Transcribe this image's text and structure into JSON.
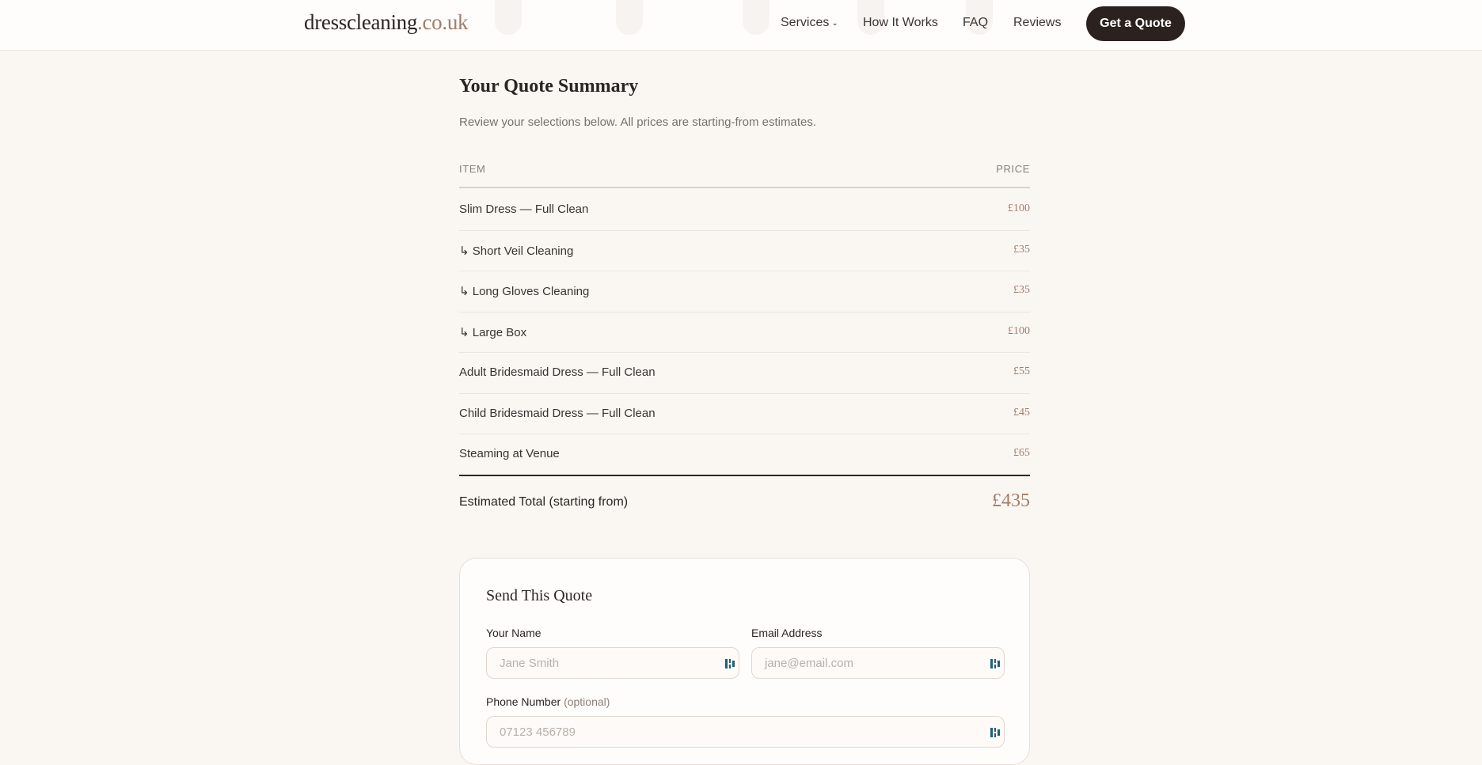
{
  "header": {
    "logo_main": "dresscleaning",
    "logo_tld": ".co.uk",
    "nav": {
      "services": "Services",
      "how_it_works": "How It Works",
      "faq": "FAQ",
      "reviews": "Reviews"
    },
    "cta_label": "Get a Quote"
  },
  "summary": {
    "title": "Your Quote Summary",
    "subtitle": "Review your selections below. All prices are starting-from estimates.",
    "columns": {
      "item": "ITEM",
      "price": "PRICE"
    },
    "rows": [
      {
        "item": "Slim Dress — Full Clean",
        "price": "£100"
      },
      {
        "item": "↳ Short Veil Cleaning",
        "price": "£35"
      },
      {
        "item": "↳ Long Gloves Cleaning",
        "price": "£35"
      },
      {
        "item": "↳ Large Box",
        "price": "£100"
      },
      {
        "item": "Adult Bridesmaid Dress — Full Clean",
        "price": "£55"
      },
      {
        "item": "Child Bridesmaid Dress — Full Clean",
        "price": "£45"
      },
      {
        "item": "Steaming at Venue",
        "price": "£65"
      }
    ],
    "total_label": "Estimated Total (starting from)",
    "total_value": "£435"
  },
  "form": {
    "title": "Send This Quote",
    "name_label": "Your Name",
    "name_placeholder": "Jane Smith",
    "email_label": "Email Address",
    "email_placeholder": "jane@email.com",
    "phone_label": "Phone Number",
    "phone_optional": "(optional)",
    "phone_placeholder": "07123 456789"
  },
  "colors": {
    "accent": "#a07d6a",
    "dark": "#2b2220",
    "background": "#faf7f3"
  }
}
